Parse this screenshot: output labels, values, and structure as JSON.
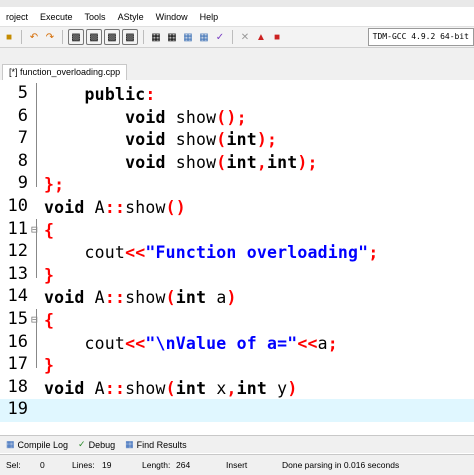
{
  "menu": [
    "roject",
    "Execute",
    "Tools",
    "AStyle",
    "Window",
    "Help"
  ],
  "compiler_select": "TDM-GCC 4.9.2 64-bit",
  "tab_label": "[*] function_overloading.cpp",
  "lines": [
    {
      "n": "5",
      "fold": "",
      "tokens": [
        {
          "t": "    "
        },
        {
          "t": "public",
          "c": "kw"
        },
        {
          "t": ":",
          "c": "sym"
        }
      ]
    },
    {
      "n": "6",
      "fold": "",
      "tokens": [
        {
          "t": "        "
        },
        {
          "t": "void",
          "c": "kw"
        },
        {
          "t": " show"
        },
        {
          "t": "();",
          "c": "sym"
        }
      ]
    },
    {
      "n": "7",
      "fold": "",
      "tokens": [
        {
          "t": "        "
        },
        {
          "t": "void",
          "c": "kw"
        },
        {
          "t": " show"
        },
        {
          "t": "(",
          "c": "sym"
        },
        {
          "t": "int",
          "c": "kw"
        },
        {
          "t": ");",
          "c": "sym"
        }
      ]
    },
    {
      "n": "8",
      "fold": "",
      "tokens": [
        {
          "t": "        "
        },
        {
          "t": "void",
          "c": "kw"
        },
        {
          "t": " show"
        },
        {
          "t": "(",
          "c": "sym"
        },
        {
          "t": "int",
          "c": "kw"
        },
        {
          "t": ",",
          "c": "sym"
        },
        {
          "t": "int",
          "c": "kw"
        },
        {
          "t": ");",
          "c": "sym"
        }
      ]
    },
    {
      "n": "9",
      "fold": "end",
      "tokens": [
        {
          "t": "};",
          "c": "sym"
        }
      ]
    },
    {
      "n": "10",
      "fold": "",
      "tokens": [
        {
          "t": "void",
          "c": "kw"
        },
        {
          "t": " A"
        },
        {
          "t": "::",
          "c": "sym"
        },
        {
          "t": "show"
        },
        {
          "t": "()",
          "c": "sym"
        }
      ]
    },
    {
      "n": "11",
      "fold": "start",
      "tokens": [
        {
          "t": "{",
          "c": "sym"
        }
      ]
    },
    {
      "n": "12",
      "fold": "",
      "tokens": [
        {
          "t": "    cout"
        },
        {
          "t": "<<",
          "c": "sym"
        },
        {
          "t": "\"Function overloading\"",
          "c": "str"
        },
        {
          "t": ";",
          "c": "sym"
        }
      ]
    },
    {
      "n": "13",
      "fold": "end",
      "tokens": [
        {
          "t": "}",
          "c": "sym"
        }
      ]
    },
    {
      "n": "14",
      "fold": "",
      "tokens": [
        {
          "t": "void",
          "c": "kw"
        },
        {
          "t": " A"
        },
        {
          "t": "::",
          "c": "sym"
        },
        {
          "t": "show"
        },
        {
          "t": "(",
          "c": "sym"
        },
        {
          "t": "int",
          "c": "kw"
        },
        {
          "t": " a"
        },
        {
          "t": ")",
          "c": "sym"
        }
      ]
    },
    {
      "n": "15",
      "fold": "start",
      "tokens": [
        {
          "t": "{",
          "c": "sym"
        }
      ]
    },
    {
      "n": "16",
      "fold": "",
      "tokens": [
        {
          "t": "    cout"
        },
        {
          "t": "<<",
          "c": "sym"
        },
        {
          "t": "\"\\nValue of a=\"",
          "c": "str"
        },
        {
          "t": "<<",
          "c": "sym"
        },
        {
          "t": "a"
        },
        {
          "t": ";",
          "c": "sym"
        }
      ]
    },
    {
      "n": "17",
      "fold": "end",
      "tokens": [
        {
          "t": "}",
          "c": "sym"
        }
      ]
    },
    {
      "n": "18",
      "fold": "",
      "tokens": [
        {
          "t": "void",
          "c": "kw"
        },
        {
          "t": " A"
        },
        {
          "t": "::",
          "c": "sym"
        },
        {
          "t": "show"
        },
        {
          "t": "(",
          "c": "sym"
        },
        {
          "t": "int",
          "c": "kw"
        },
        {
          "t": " x"
        },
        {
          "t": ",",
          "c": "sym"
        },
        {
          "t": "int",
          "c": "kw"
        },
        {
          "t": " y"
        },
        {
          "t": ")",
          "c": "sym"
        }
      ]
    },
    {
      "n": "19",
      "fold": "",
      "active": true,
      "tokens": []
    }
  ],
  "bottom_tabs": {
    "compile_log": "Compile Log",
    "debug": "Debug",
    "find_results": "Find Results"
  },
  "status": {
    "sel_label": "Sel:",
    "sel": "0",
    "lines_label": "Lines:",
    "lines": "19",
    "length_label": "Length:",
    "length": "264",
    "mode": "Insert",
    "message": "Done parsing in 0.016 seconds"
  }
}
